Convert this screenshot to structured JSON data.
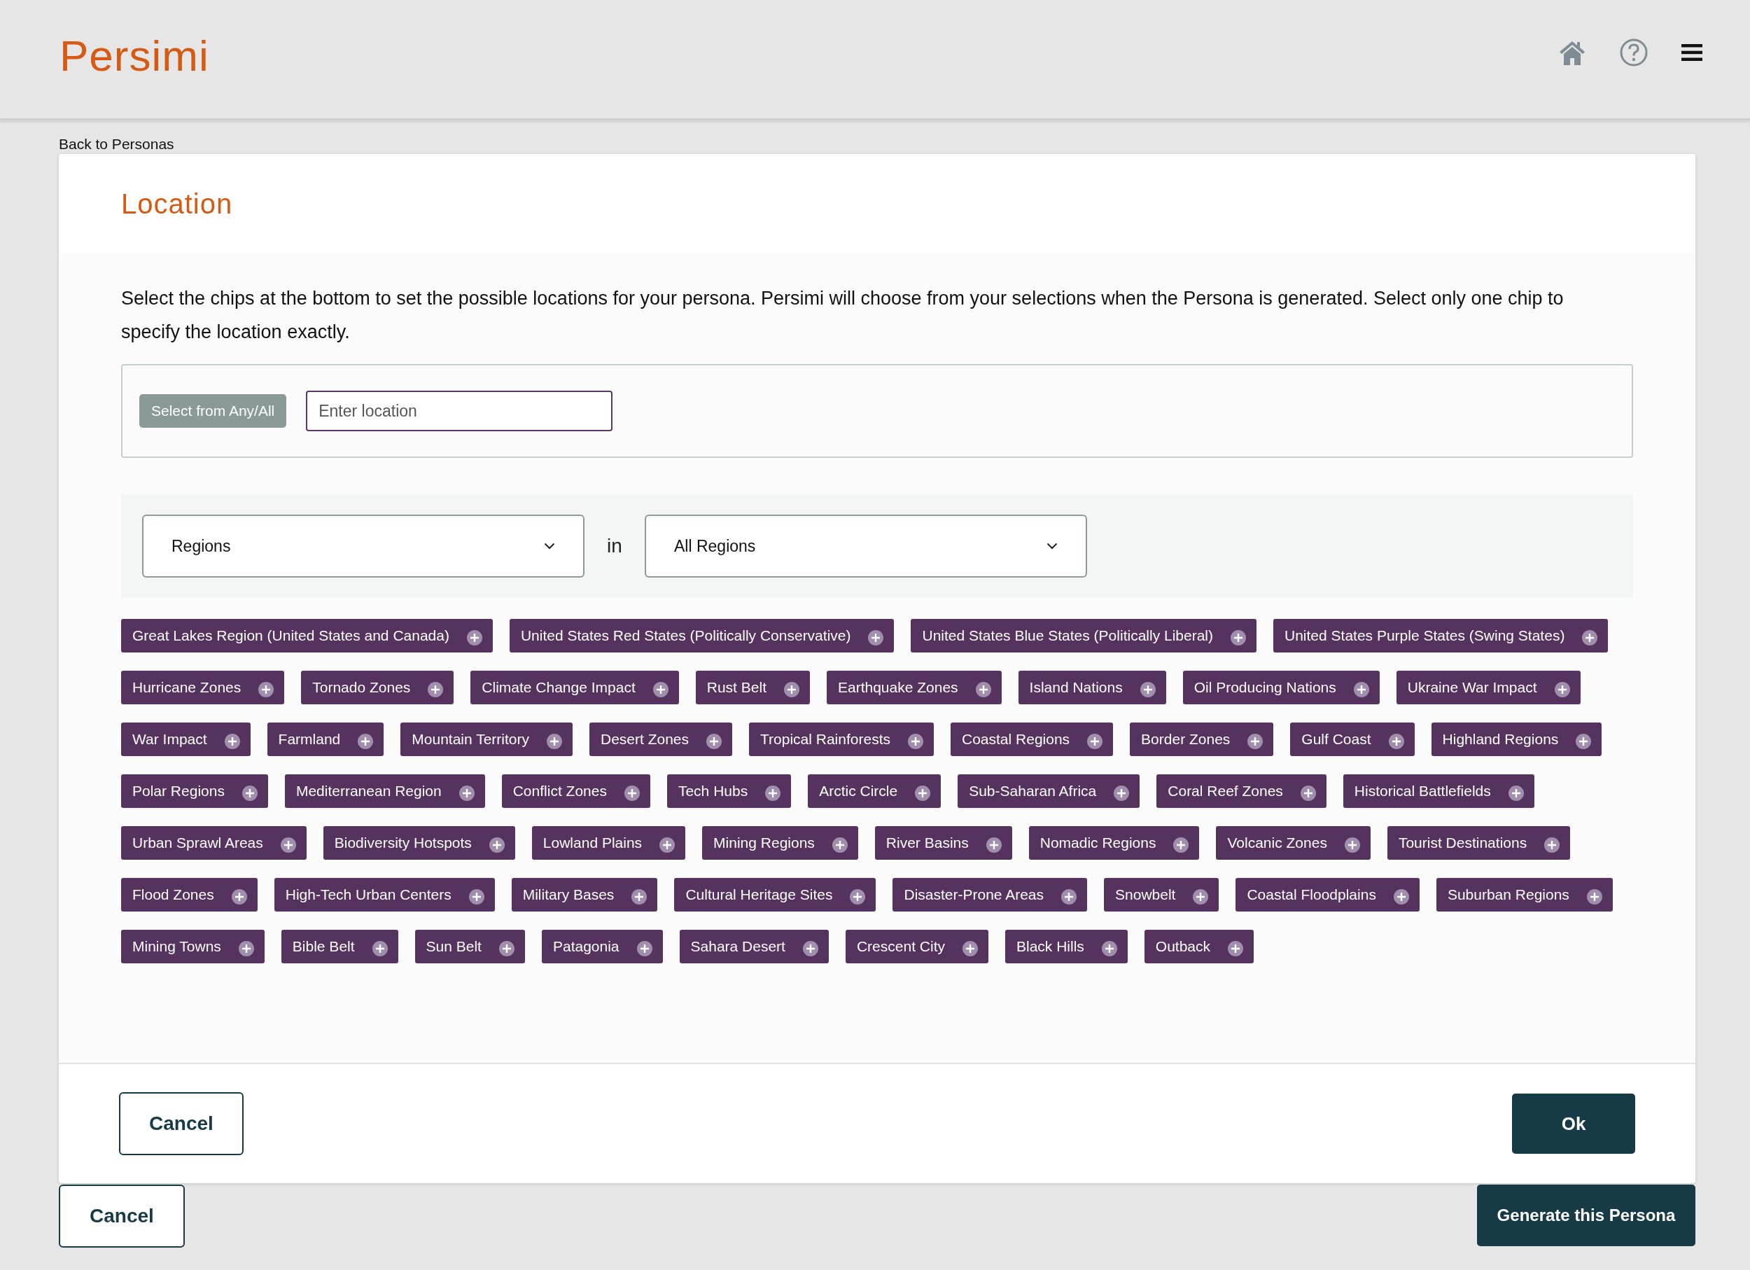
{
  "header": {
    "logo": "Persimi"
  },
  "back_link": "Back to Personas",
  "dialog": {
    "title": "Location",
    "description": "Select the chips at the bottom to set the possible locations for your persona. Persimi will choose from your selections when the Persona is generated. Select only one chip to specify the location exactly.",
    "select_button": "Select from Any/All",
    "location_field": {
      "placeholder": "Enter location"
    },
    "category_select": "Regions",
    "connector": "in",
    "scope_select": "All Regions",
    "chips": [
      "Great Lakes Region (United States and Canada)",
      "United States Red States (Politically Conservative)",
      "United States Blue States (Politically Liberal)",
      "United States Purple States (Swing States)",
      "Hurricane Zones",
      "Tornado Zones",
      "Climate Change Impact",
      "Rust Belt",
      "Earthquake Zones",
      "Island Nations",
      "Oil Producing Nations",
      "Ukraine War Impact",
      "War Impact",
      "Farmland",
      "Mountain Territory",
      "Desert Zones",
      "Tropical Rainforests",
      "Coastal Regions",
      "Border Zones",
      "Gulf Coast",
      "Highland Regions",
      "Polar Regions",
      "Mediterranean Region",
      "Conflict Zones",
      "Tech Hubs",
      "Arctic Circle",
      "Sub-Saharan Africa",
      "Coral Reef Zones",
      "Historical Battlefields",
      "Urban Sprawl Areas",
      "Biodiversity Hotspots",
      "Lowland Plains",
      "Mining Regions",
      "River Basins",
      "Nomadic Regions",
      "Volcanic Zones",
      "Tourist Destinations",
      "Flood Zones",
      "High-Tech Urban Centers",
      "Military Bases",
      "Cultural Heritage Sites",
      "Disaster-Prone Areas",
      "Snowbelt",
      "Coastal Floodplains",
      "Suburban Regions",
      "Mining Towns",
      "Bible Belt",
      "Sun Belt",
      "Patagonia",
      "Sahara Desert",
      "Crescent City",
      "Black Hills",
      "Outback"
    ],
    "cancel_button": "Cancel",
    "ok_button": "Ok"
  },
  "footer": {
    "cancel_button": "Cancel",
    "generate_button": "Generate this Persona"
  }
}
